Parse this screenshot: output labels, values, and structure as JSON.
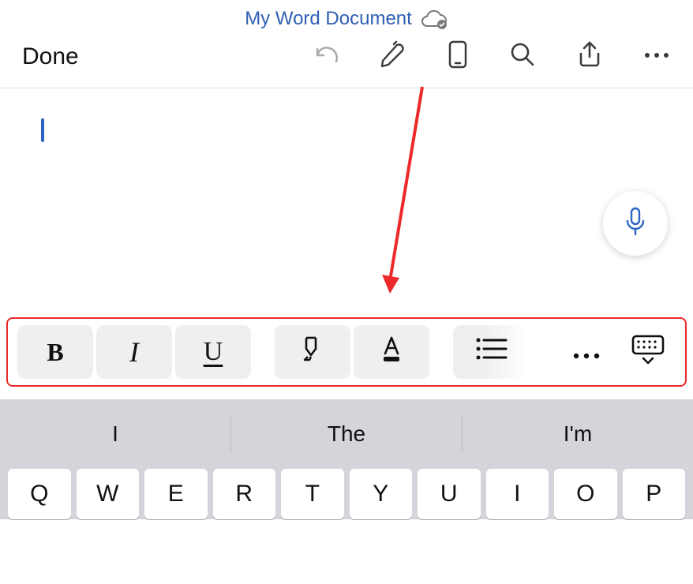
{
  "header": {
    "title": "My Word Document"
  },
  "top_actions": {
    "done_label": "Done"
  },
  "format_toolbar": {
    "bold_glyph": "B",
    "italic_glyph": "I",
    "underline_glyph": "U"
  },
  "predictive": {
    "suggestions": [
      "I",
      "The",
      "I'm"
    ]
  },
  "keyboard": {
    "row1": [
      "Q",
      "W",
      "E",
      "R",
      "T",
      "Y",
      "U",
      "I",
      "O",
      "P"
    ]
  }
}
